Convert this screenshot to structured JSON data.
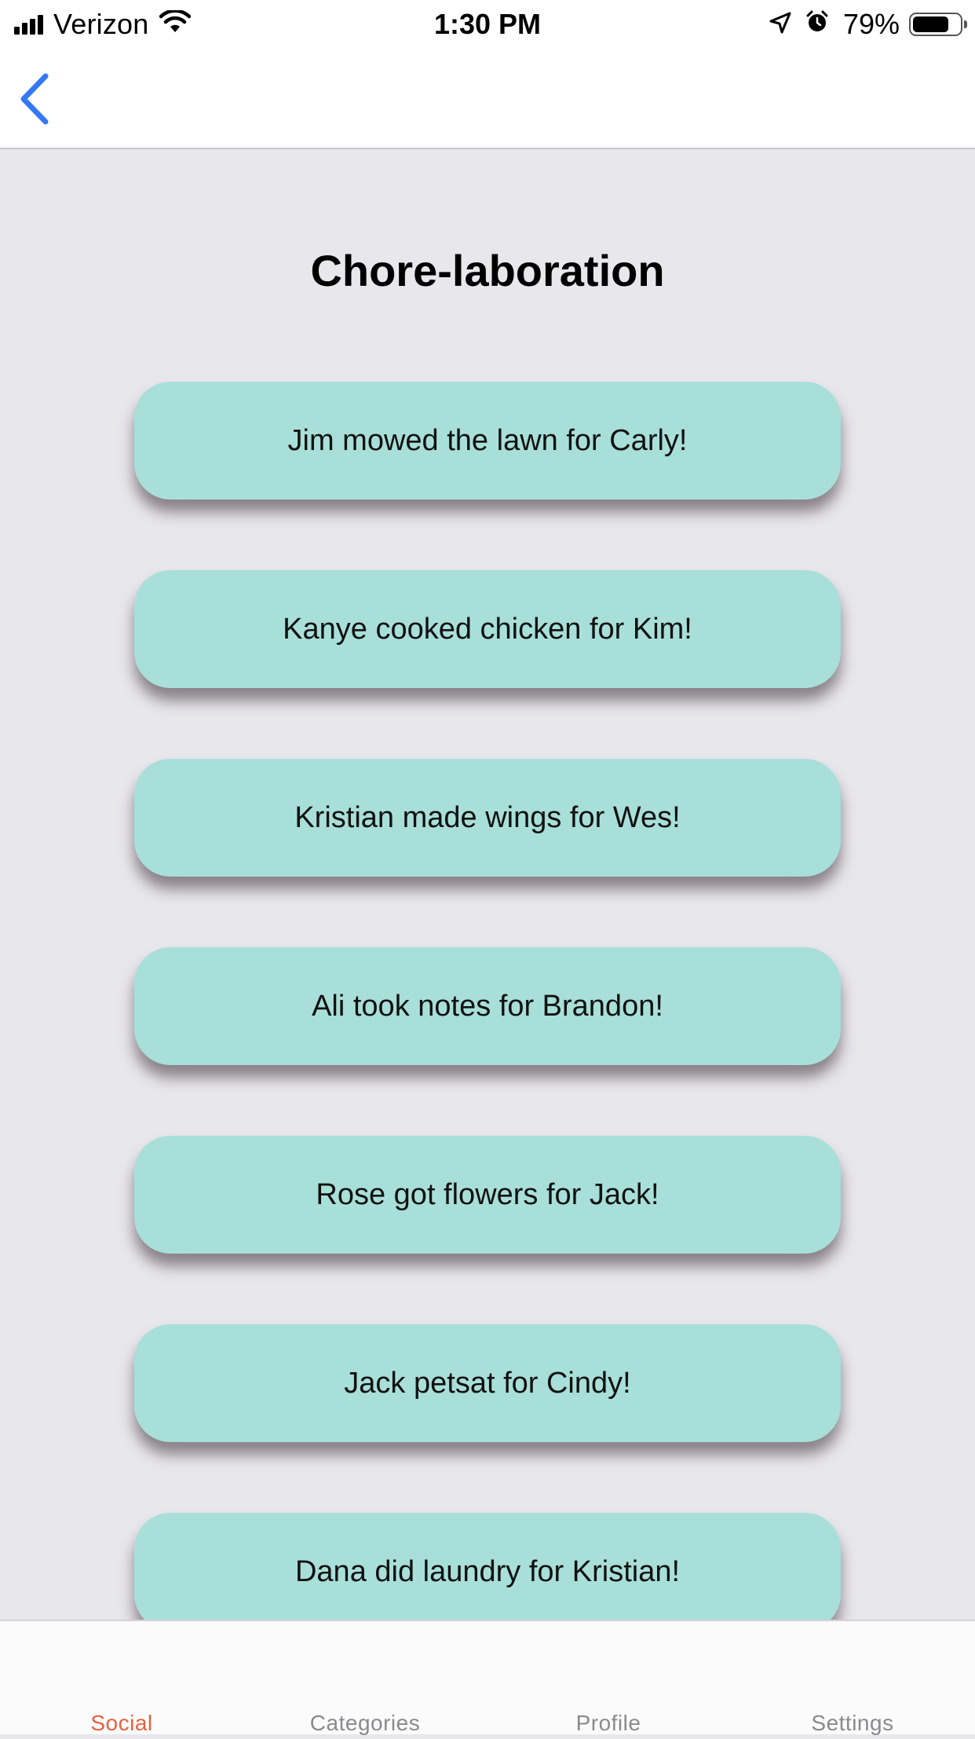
{
  "status_bar": {
    "carrier": "Verizon",
    "time": "1:30 PM",
    "battery_percent": "79%",
    "battery_level": 0.79,
    "icons": [
      "signal-icon",
      "wifi-icon",
      "location-arrow-icon",
      "alarm-icon",
      "battery-icon"
    ]
  },
  "nav": {
    "back_icon": "chevron-left-icon",
    "accent_color": "#3478f6"
  },
  "page": {
    "title": "Chore-laboration"
  },
  "feed": {
    "card_color": "#a8dfd9",
    "items": [
      "Jim mowed the lawn for Carly!",
      "Kanye cooked chicken for Kim!",
      "Kristian made wings for Wes!",
      "Ali took notes for Brandon!",
      "Rose got flowers for Jack!",
      "Jack petsat for Cindy!",
      "Dana did laundry for Kristian!"
    ]
  },
  "tab_bar": {
    "active_color": "#e8613f",
    "tabs": [
      {
        "label": "Social",
        "active": true
      },
      {
        "label": "Categories",
        "active": false
      },
      {
        "label": "Profile",
        "active": false
      },
      {
        "label": "Settings",
        "active": false
      }
    ]
  }
}
